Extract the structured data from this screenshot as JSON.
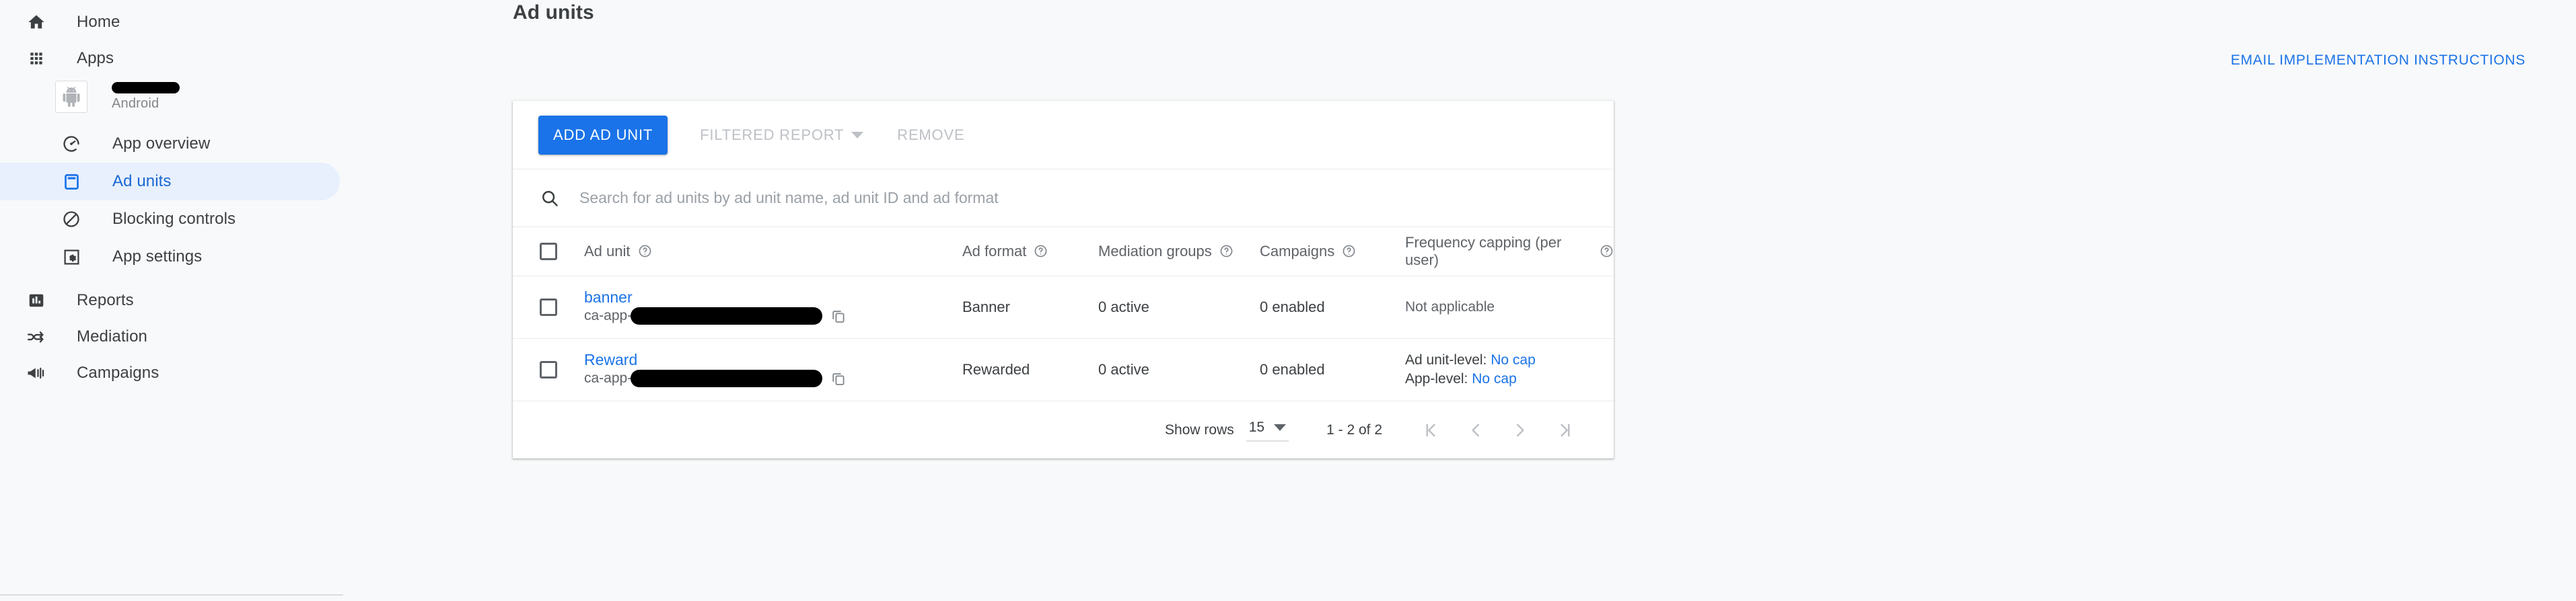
{
  "sidebar": {
    "top_items": [
      {
        "label": "Home",
        "icon": "home-icon"
      },
      {
        "label": "Apps",
        "icon": "apps-grid-icon"
      }
    ],
    "app_chip": {
      "name_redacted": true,
      "platform": "Android",
      "icon": "android-icon"
    },
    "app_items": [
      {
        "label": "App overview",
        "icon": "speedometer-icon",
        "selected": false
      },
      {
        "label": "Ad units",
        "icon": "ad-unit-icon",
        "selected": true
      },
      {
        "label": "Blocking controls",
        "icon": "block-icon",
        "selected": false
      },
      {
        "label": "App settings",
        "icon": "settings-icon",
        "selected": false
      }
    ],
    "bottom_items": [
      {
        "label": "Reports",
        "icon": "bar-chart-icon"
      },
      {
        "label": "Mediation",
        "icon": "mediation-icon"
      },
      {
        "label": "Campaigns",
        "icon": "megaphone-icon"
      }
    ]
  },
  "header": {
    "title": "Ad units",
    "email_instructions_label": "EMAIL IMPLEMENTATION INSTRUCTIONS"
  },
  "toolbar": {
    "add_ad_unit_label": "ADD AD UNIT",
    "filtered_report_label": "FILTERED REPORT",
    "remove_label": "REMOVE"
  },
  "search": {
    "placeholder": "Search for ad units by ad unit name, ad unit ID and ad format",
    "value": "",
    "icon": "search-icon"
  },
  "table": {
    "columns": [
      {
        "key": "checkbox",
        "label": ""
      },
      {
        "key": "ad_unit",
        "label": "Ad unit",
        "help": true
      },
      {
        "key": "ad_format",
        "label": "Ad format",
        "help": true
      },
      {
        "key": "mediation_groups",
        "label": "Mediation groups",
        "help": true
      },
      {
        "key": "campaigns",
        "label": "Campaigns",
        "help": true
      },
      {
        "key": "frequency_capping",
        "label": "Frequency capping (per user)",
        "help": true
      }
    ],
    "rows": [
      {
        "selected": false,
        "ad_unit_name": "banner",
        "ad_unit_id_prefix": "ca-app-",
        "ad_unit_id_redacted": true,
        "copy_icon": "copy-icon",
        "ad_format": "Banner",
        "mediation_groups": "0 active",
        "campaigns": "0 enabled",
        "frequency_capping": {
          "type": "text",
          "text": "Not applicable"
        }
      },
      {
        "selected": false,
        "ad_unit_name": "Reward",
        "ad_unit_id_prefix": "ca-app-",
        "ad_unit_id_redacted": true,
        "copy_icon": "copy-icon",
        "ad_format": "Rewarded",
        "mediation_groups": "0 active",
        "campaigns": "0 enabled",
        "frequency_capping": {
          "type": "links",
          "ad_unit_level_label": "Ad unit-level:",
          "ad_unit_level_value": "No cap",
          "app_level_label": "App-level:",
          "app_level_value": "No cap"
        }
      }
    ]
  },
  "pagination": {
    "show_rows_label": "Show rows",
    "rows_per_page": "15",
    "range_label": "1 - 2 of 2",
    "first_page_icon": "first-page-icon",
    "prev_page_icon": "prev-page-icon",
    "next_page_icon": "next-page-icon",
    "last_page_icon": "last-page-icon"
  },
  "colors": {
    "accent_blue": "#1a73e8",
    "selected_pill": "#e8f0fe",
    "page_bg": "#f8f9fa",
    "card_bg": "#ffffff",
    "text_primary": "#3c4043",
    "text_secondary": "#5f6368",
    "disabled": "#bdc1c6"
  }
}
